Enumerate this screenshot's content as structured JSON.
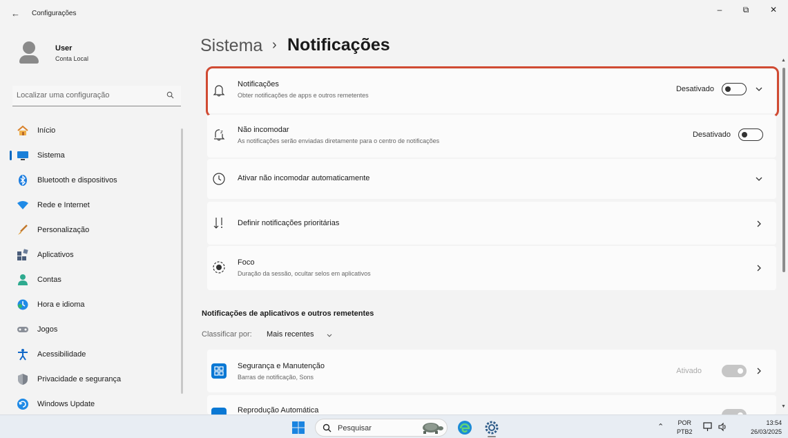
{
  "window": {
    "app_title": "Configurações",
    "back_icon": "arrow-left-icon",
    "controls": {
      "minimize": "–",
      "restore": "⧉",
      "close": "✕"
    }
  },
  "user": {
    "name": "User",
    "subtitle": "Conta Local"
  },
  "search": {
    "placeholder": "Localizar uma configuração",
    "icon": "search-icon"
  },
  "sidebar": {
    "items": [
      {
        "label": "Início",
        "icon": "home-icon",
        "active": false
      },
      {
        "label": "Sistema",
        "icon": "monitor-icon",
        "active": true
      },
      {
        "label": "Bluetooth e dispositivos",
        "icon": "bluetooth-icon",
        "active": false
      },
      {
        "label": "Rede e Internet",
        "icon": "wifi-icon",
        "active": false
      },
      {
        "label": "Personalização",
        "icon": "brush-icon",
        "active": false
      },
      {
        "label": "Aplicativos",
        "icon": "apps-icon",
        "active": false
      },
      {
        "label": "Contas",
        "icon": "person-icon",
        "active": false
      },
      {
        "label": "Hora e idioma",
        "icon": "globe-clock-icon",
        "active": false
      },
      {
        "label": "Jogos",
        "icon": "gamepad-icon",
        "active": false
      },
      {
        "label": "Acessibilidade",
        "icon": "accessibility-icon",
        "active": false
      },
      {
        "label": "Privacidade e segurança",
        "icon": "shield-icon",
        "active": false
      },
      {
        "label": "Windows Update",
        "icon": "update-icon",
        "active": false
      }
    ]
  },
  "breadcrumb": {
    "parent": "Sistema",
    "separator": "›",
    "current": "Notificações"
  },
  "settings": {
    "notifications": {
      "title": "Notificações",
      "subtitle": "Obter notificações de apps e outros remetentes",
      "state": "Desativado",
      "on": false,
      "icon": "bell-icon"
    },
    "do_not_disturb": {
      "title": "Não incomodar",
      "subtitle": "As notificações serão enviadas diretamente para o centro de notificações",
      "state": "Desativado",
      "on": false,
      "icon": "bell-snooze-icon"
    },
    "auto_dnd": {
      "title": "Ativar não incomodar automaticamente",
      "icon": "clock-icon"
    },
    "priority": {
      "title": "Definir notificações prioritárias",
      "icon": "sort-priority-icon"
    },
    "focus": {
      "title": "Foco",
      "subtitle": "Duração da sessão, ocultar selos em aplicativos",
      "icon": "focus-icon"
    }
  },
  "apps_section": {
    "title": "Notificações de aplicativos e outros remetentes",
    "sort_label": "Classificar por:",
    "sort_value": "Mais recentes",
    "apps": [
      {
        "name": "Segurança e Manutenção",
        "subtitle": "Barras de notificação, Sons",
        "state": "Ativado",
        "on": true,
        "icon": "security-maintenance-icon"
      },
      {
        "name": "Reprodução Automática",
        "icon": "autoplay-icon"
      }
    ]
  },
  "taskbar": {
    "search_placeholder": "Pesquisar",
    "language": {
      "line1": "POR",
      "line2": "PTB2"
    },
    "time": "13:54",
    "date": "26/03/2025"
  },
  "colors": {
    "accent": "#0067c0",
    "highlight": "#d04a32",
    "tile": "#0a78d4"
  }
}
